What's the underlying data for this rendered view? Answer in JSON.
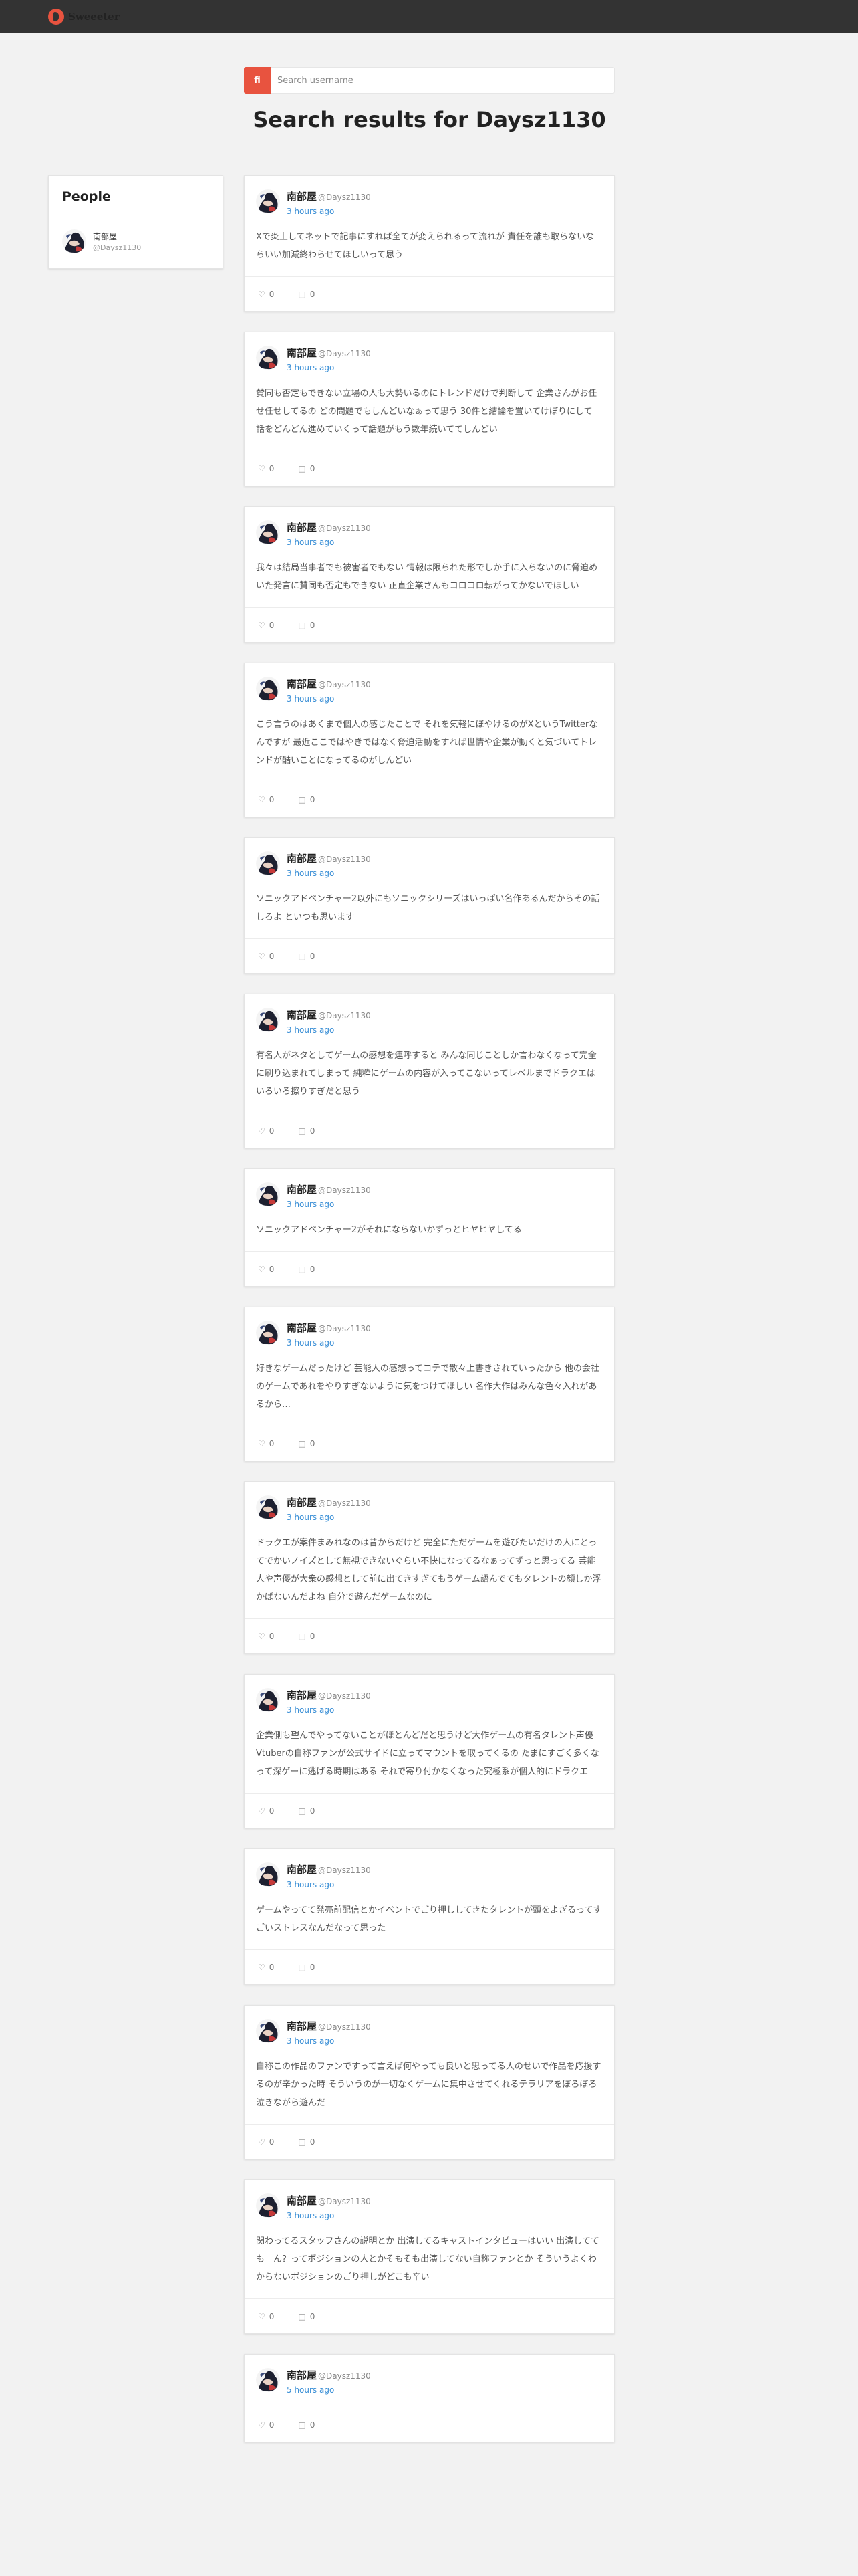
{
  "header": {
    "logo_text": "Sweeeter"
  },
  "search": {
    "button_label": "fi",
    "placeholder": "Search username"
  },
  "page": {
    "title": "Search results for Daysz1130"
  },
  "people": {
    "title": "People",
    "items": [
      {
        "name": "南部屋",
        "handle": "@Daysz1130"
      }
    ]
  },
  "posts": [
    {
      "name": "南部屋",
      "handle": "@Daysz1130",
      "time": "3 hours ago",
      "likes": "0",
      "comments": "0",
      "text": "Xで炎上してネットで記事にすれば全てが変えられるって流れが 責任を誰も取らないならいい加減終わらせてほしいって思う"
    },
    {
      "name": "南部屋",
      "handle": "@Daysz1130",
      "time": "3 hours ago",
      "likes": "0",
      "comments": "0",
      "text": "賛同も否定もできない立場の人も大勢いるのにトレンドだけで判断して 企業さんがお任せ任せしてるの どの問題でもしんどいなぁって思う 30件と結論を置いてけぼりにして 話をどんどん進めていくって話題がもう数年続いててしんどい"
    },
    {
      "name": "南部屋",
      "handle": "@Daysz1130",
      "time": "3 hours ago",
      "likes": "0",
      "comments": "0",
      "text": "我々は結局当事者でも被害者でもない 情報は限られた形でしか手に入らないのに脅迫めいた発言に賛同も否定もできない 正直企業さんもコロコロ転がってかないでほしい"
    },
    {
      "name": "南部屋",
      "handle": "@Daysz1130",
      "time": "3 hours ago",
      "likes": "0",
      "comments": "0",
      "text": "こう言うのはあくまで個人の感じたことで それを気軽にぼやけるのがXというTwitterなんですが 最近ここではやきではなく脅迫活動をすれば世情や企業が動くと気づいてトレンドが酷いことになってるのがしんどい"
    },
    {
      "name": "南部屋",
      "handle": "@Daysz1130",
      "time": "3 hours ago",
      "likes": "0",
      "comments": "0",
      "text": "ソニックアドベンチャー2以外にもソニックシリーズはいっぱい名作あるんだからその話しろよ といつも思います"
    },
    {
      "name": "南部屋",
      "handle": "@Daysz1130",
      "time": "3 hours ago",
      "likes": "0",
      "comments": "0",
      "text": "有名人がネタとしてゲームの感想を連呼すると みんな同じことしか言わなくなって完全に刷り込まれてしまって 純粋にゲームの内容が入ってこないってレベルまでドラクエはいろいろ擦りすぎだと思う"
    },
    {
      "name": "南部屋",
      "handle": "@Daysz1130",
      "time": "3 hours ago",
      "likes": "0",
      "comments": "0",
      "text": "ソニックアドベンチャー2がそれにならないかずっとヒヤヒヤしてる"
    },
    {
      "name": "南部屋",
      "handle": "@Daysz1130",
      "time": "3 hours ago",
      "likes": "0",
      "comments": "0",
      "text": "好きなゲームだったけど 芸能人の感想ってコテで散々上書きされていったから 他の会社のゲームであれをやりすぎないように気をつけてほしい 名作大作はみんな色々入れがあるから…"
    },
    {
      "name": "南部屋",
      "handle": "@Daysz1130",
      "time": "3 hours ago",
      "likes": "0",
      "comments": "0",
      "text": "ドラクエが案件まみれなのは昔からだけど 完全にただゲームを遊びたいだけの人にとってでかいノイズとして無視できないぐらい不快になってるなぁってずっと思ってる 芸能人や声優が大衆の感想として前に出てきすぎてもうゲーム語んでてもタレントの顔しか浮かばないんだよね 自分で遊んだゲームなのに"
    },
    {
      "name": "南部屋",
      "handle": "@Daysz1130",
      "time": "3 hours ago",
      "likes": "0",
      "comments": "0",
      "text": "企業側も望んでやってないことがほとんどだと思うけど大作ゲームの有名タレント声優Vtuberの自称ファンが公式サイドに立ってマウントを取ってくるの たまにすごく多くなって深ゲーに逃げる時期はある それで寄り付かなくなった究極系が個人的にドラクエ"
    },
    {
      "name": "南部屋",
      "handle": "@Daysz1130",
      "time": "3 hours ago",
      "likes": "0",
      "comments": "0",
      "text": "ゲームやってて発売前配信とかイベントでごり押ししてきたタレントが頭をよぎるってすごいストレスなんだなって思った"
    },
    {
      "name": "南部屋",
      "handle": "@Daysz1130",
      "time": "3 hours ago",
      "likes": "0",
      "comments": "0",
      "text": "自称この作品のファンですって言えば何やっても良いと思ってる人のせいで作品を応援するのが辛かった時 そういうのが一切なくゲームに集中させてくれるテラリアをぼろぼろ泣きながら遊んだ"
    },
    {
      "name": "南部屋",
      "handle": "@Daysz1130",
      "time": "3 hours ago",
      "likes": "0",
      "comments": "0",
      "text": "関わってるスタッフさんの説明とか 出演してるキャストインタビューはいい 出演してても　ん？ってポジションの人とかそもそも出演してない自称ファンとか そういうよくわからないポジションのごり押しがどこも辛い"
    },
    {
      "name": "南部屋",
      "handle": "@Daysz1130",
      "time": "5 hours ago",
      "likes": "0",
      "comments": "0",
      "text": ""
    }
  ],
  "colors": {
    "topbar": "#333333",
    "accent": "#e8533f",
    "time_link": "#3a8fd6"
  },
  "icons": {
    "logo": "sweeter-bird-logo",
    "like": "heart-icon",
    "comment": "comment-icon"
  }
}
